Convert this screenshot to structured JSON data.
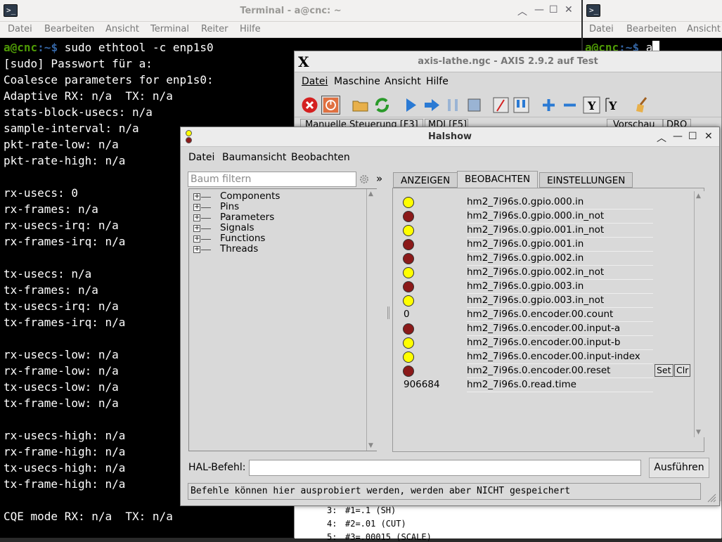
{
  "term1": {
    "title": "Terminal - a@cnc: ~",
    "menu": [
      "Datei",
      "Bearbeiten",
      "Ansicht",
      "Terminal",
      "Reiter",
      "Hilfe"
    ],
    "prompt_user": "a@cnc",
    "prompt_path": ":~$",
    "command": " sudo ethtool -c enp1s0",
    "lines": [
      "[sudo] Passwort für a:",
      "Coalesce parameters for enp1s0:",
      "Adaptive RX: n/a  TX: n/a",
      "stats-block-usecs: n/a",
      "sample-interval: n/a",
      "pkt-rate-low: n/a",
      "pkt-rate-high: n/a",
      "",
      "rx-usecs: 0",
      "rx-frames: n/a",
      "rx-usecs-irq: n/a",
      "rx-frames-irq: n/a",
      "",
      "tx-usecs: n/a",
      "tx-frames: n/a",
      "tx-usecs-irq: n/a",
      "tx-frames-irq: n/a",
      "",
      "rx-usecs-low: n/a",
      "rx-frame-low: n/a",
      "tx-usecs-low: n/a",
      "tx-frame-low: n/a",
      "",
      "rx-usecs-high: n/a",
      "rx-frame-high: n/a",
      "tx-usecs-high: n/a",
      "tx-frame-high: n/a",
      "",
      "CQE mode RX: n/a  TX: n/a"
    ]
  },
  "term2": {
    "menu": [
      "Datei",
      "Bearbeiten",
      "Ansicht"
    ],
    "prompt_user": "a@cnc",
    "prompt_path": ":~$",
    "command": " a"
  },
  "axis": {
    "title": "axis-lathe.ngc - AXIS 2.9.2 auf Test",
    "menu": [
      "Datei",
      "Maschine",
      "Ansicht",
      "Hilfe"
    ],
    "tabs": [
      "Manuelle Steuerung [F3]",
      "MDI [F5]",
      "Vorschau",
      "DRO"
    ],
    "code_lines": [
      {
        "num": "3:",
        "text": "#1=.1 (SH)"
      },
      {
        "num": "4:",
        "text": "#2=.01 (CUT)"
      },
      {
        "num": "5:",
        "text": "#3=.00015 (SCALE)"
      }
    ]
  },
  "halshow": {
    "title": "Halshow",
    "menu": [
      "Datei",
      "Baumansicht",
      "Beobachten"
    ],
    "filter_placeholder": "Baum filtern",
    "expand_glyph": "»",
    "tree": [
      "Components",
      "Pins",
      "Parameters",
      "Signals",
      "Functions",
      "Threads"
    ],
    "tabs": [
      "ANZEIGEN",
      "BEOBACHTEN",
      "EINSTELLUNGEN"
    ],
    "watch": [
      {
        "type": "led",
        "state": "on",
        "name": "hm2_7i96s.0.gpio.000.in"
      },
      {
        "type": "led",
        "state": "off",
        "name": "hm2_7i96s.0.gpio.000.in_not"
      },
      {
        "type": "led",
        "state": "on",
        "name": "hm2_7i96s.0.gpio.001.in_not"
      },
      {
        "type": "led",
        "state": "off",
        "name": "hm2_7i96s.0.gpio.001.in"
      },
      {
        "type": "led",
        "state": "off",
        "name": "hm2_7i96s.0.gpio.002.in"
      },
      {
        "type": "led",
        "state": "on",
        "name": "hm2_7i96s.0.gpio.002.in_not"
      },
      {
        "type": "led",
        "state": "off",
        "name": "hm2_7i96s.0.gpio.003.in"
      },
      {
        "type": "led",
        "state": "on",
        "name": "hm2_7i96s.0.gpio.003.in_not"
      },
      {
        "type": "value",
        "value": "0",
        "name": "hm2_7i96s.0.encoder.00.count"
      },
      {
        "type": "led",
        "state": "off",
        "name": "hm2_7i96s.0.encoder.00.input-a"
      },
      {
        "type": "led",
        "state": "on",
        "name": "hm2_7i96s.0.encoder.00.input-b"
      },
      {
        "type": "led",
        "state": "on",
        "name": "hm2_7i96s.0.encoder.00.input-index"
      },
      {
        "type": "led",
        "state": "off",
        "name": "hm2_7i96s.0.encoder.00.reset",
        "buttons": [
          "Set",
          "Clr"
        ]
      },
      {
        "type": "value",
        "value": "906684",
        "name": "hm2_7i96s.0.read.time"
      }
    ],
    "halcmd_label": "HAL-Befehl:",
    "execute_label": "Ausführen",
    "status": "Befehle können hier ausprobiert werden, werden aber NICHT gespeichert"
  },
  "colors": {
    "led_on": "#ffff00",
    "led_off": "#8b1a1a",
    "prompt_user": "#4e9a06",
    "prompt_path": "#3465a4"
  }
}
